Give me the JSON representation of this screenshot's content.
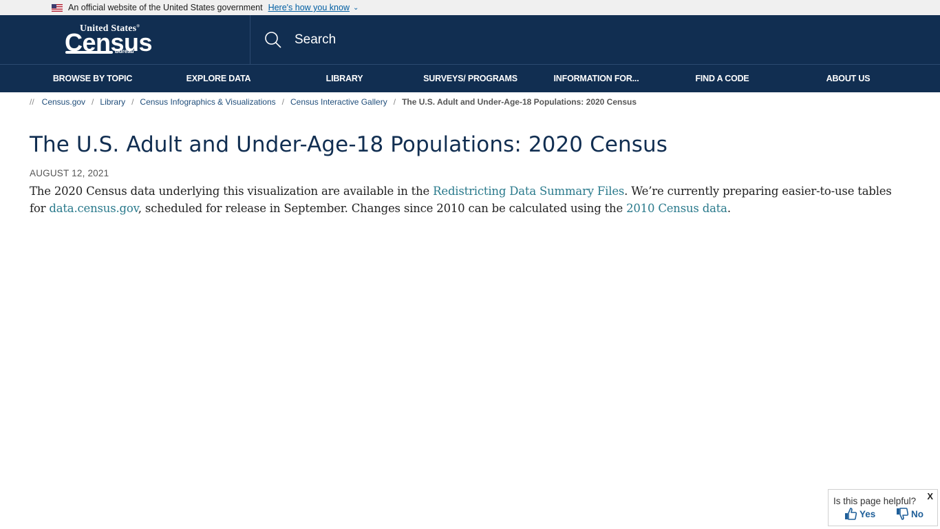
{
  "gov_banner": {
    "text": "An official website of the United States government",
    "link": "Here's how you know",
    "flag_icon": "us-flag-icon",
    "chevron_icon": "chevron-down-icon"
  },
  "header": {
    "logo": {
      "top": "United States",
      "main": "Census",
      "sub": "Bureau",
      "reg": "®"
    },
    "search_label": "Search",
    "search_icon": "search-icon"
  },
  "nav": {
    "items": [
      {
        "label": "BROWSE BY TOPIC"
      },
      {
        "label": "EXPLORE DATA"
      },
      {
        "label": "LIBRARY"
      },
      {
        "label": "SURVEYS/ PROGRAMS"
      },
      {
        "label": "INFORMATION FOR..."
      },
      {
        "label": "FIND A CODE"
      },
      {
        "label": "ABOUT US"
      }
    ]
  },
  "breadcrumb": {
    "lead": "//",
    "separator": "/",
    "items": [
      {
        "label": "Census.gov"
      },
      {
        "label": "Library"
      },
      {
        "label": "Census Infographics & Visualizations"
      },
      {
        "label": "Census Interactive Gallery"
      }
    ],
    "current": "The U.S. Adult and Under-Age-18 Populations: 2020 Census"
  },
  "main": {
    "title": "The U.S. Adult and Under-Age-18 Populations: 2020 Census",
    "date": "AUGUST 12, 2021",
    "body": {
      "t1": "The 2020 Census data underlying this visualization are available in the ",
      "link1": "Redistricting Data Summary Files",
      "t2": ". We’re currently preparing easier-to-use tables for ",
      "link2": "data.census.gov",
      "t3": ", scheduled for release in September. Changes since 2010 can be calculated using the ",
      "link3": "2010 Census data",
      "t4": "."
    }
  },
  "feedback": {
    "question": "Is this page helpful?",
    "close": "X",
    "yes": "Yes",
    "no": "No",
    "color": "#1f5f99"
  },
  "colors": {
    "header_bg": "#112e51",
    "link": "#2a7a8c",
    "gov_link": "#005ea2"
  }
}
